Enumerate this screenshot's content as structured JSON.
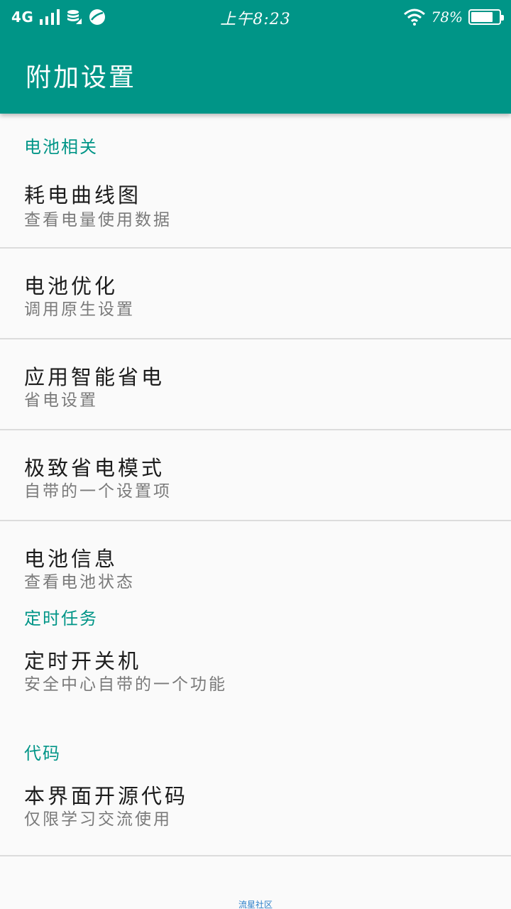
{
  "status_bar": {
    "network": "4G",
    "time": "上午8:23",
    "battery_pct": "78%",
    "battery_level": 0.78
  },
  "app_bar": {
    "title": "附加设置"
  },
  "sections": [
    {
      "header": "电池相关",
      "items": [
        {
          "title": "耗电曲线图",
          "summary": "查看电量使用数据"
        },
        {
          "title": "电池优化",
          "summary": "调用原生设置"
        },
        {
          "title": "应用智能省电",
          "summary": "省电设置"
        },
        {
          "title": "极致省电模式",
          "summary": "自带的一个设置项"
        },
        {
          "title": "电池信息",
          "summary": "查看电池状态"
        }
      ]
    },
    {
      "header": "定时任务",
      "items": [
        {
          "title": "定时开关机",
          "summary": "安全中心自带的一个功能"
        }
      ]
    },
    {
      "header": "代码",
      "items": [
        {
          "title": "本界面开源代码",
          "summary": "仅限学习交流使用"
        }
      ]
    }
  ],
  "watermark": "流星社区",
  "colors": {
    "accent": "#009587",
    "background": "#fafafa"
  }
}
